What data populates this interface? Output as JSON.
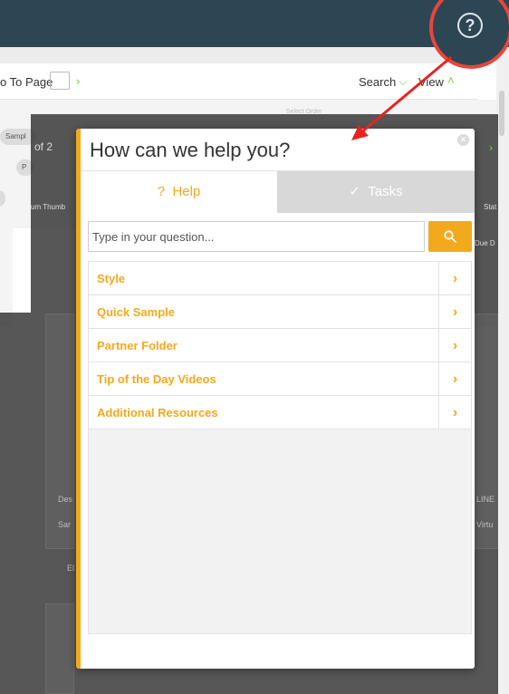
{
  "toolbar": {
    "go_to_page_label": "o To Page",
    "search_label": "Search",
    "view_label": "View"
  },
  "background": {
    "select_order": "Select Order",
    "of_pages": "of 2",
    "pill_sample": "Sampl",
    "pill_p": "P",
    "col_thumb": "um Thumb",
    "col_status": "Stat",
    "due_date": "Due D",
    "line_text": "LINE",
    "des_text": "Des",
    "sar_text": "Sar",
    "el_text": "El",
    "virtual_text": "Virtu"
  },
  "dialog": {
    "title": "How can we help you?",
    "tabs": [
      {
        "label": "Help",
        "icon": "question-icon",
        "active": true
      },
      {
        "label": "Tasks",
        "icon": "check-icon",
        "active": false
      }
    ],
    "search": {
      "placeholder": "Type in your question...",
      "value": ""
    },
    "topics": [
      {
        "label": "Style"
      },
      {
        "label": "Quick Sample"
      },
      {
        "label": "Partner Folder"
      },
      {
        "label": "Tip of the Day Videos"
      },
      {
        "label": "Additional Resources"
      }
    ]
  },
  "colors": {
    "accent": "#f3a91d",
    "header": "#2c4653",
    "highlight": "#e8453c"
  }
}
